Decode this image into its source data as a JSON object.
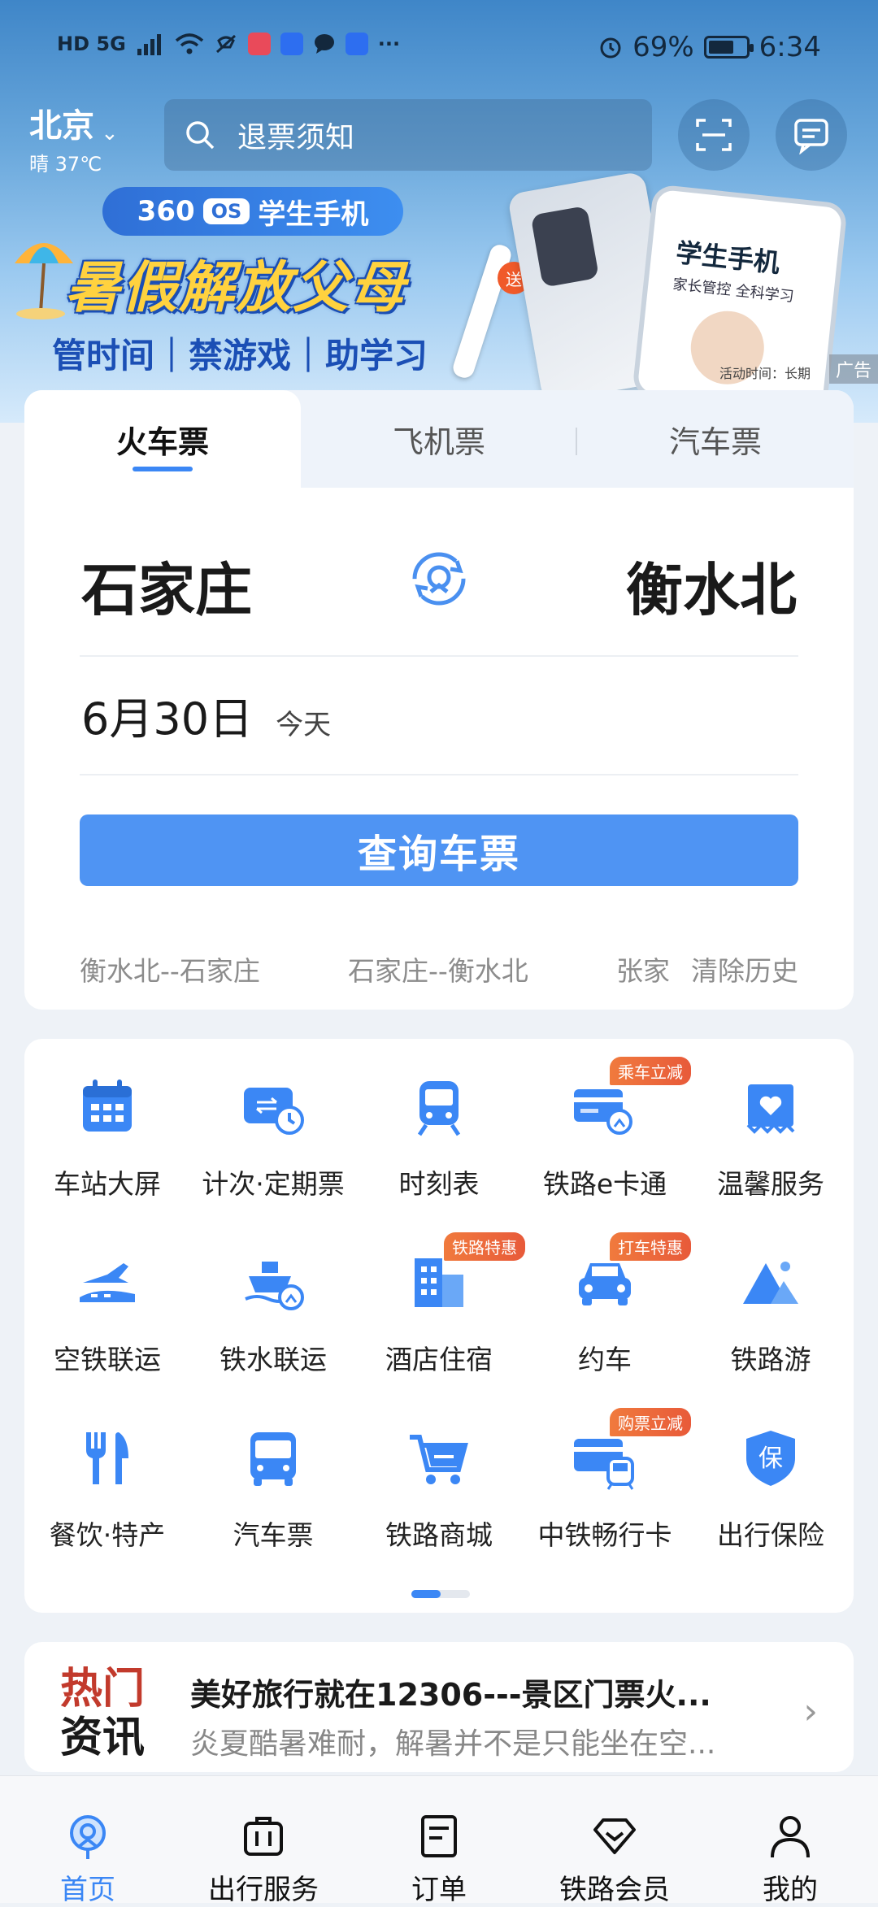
{
  "status_bar": {
    "network": "HD 5G",
    "battery_percent": "69%",
    "battery_level": 0.69,
    "time": "6:34"
  },
  "header": {
    "city": "北京",
    "weather": "晴 37℃",
    "search_placeholder": "退票须知"
  },
  "banner": {
    "os_brand": "360",
    "os_badge": "OS",
    "os_title": "学生手机",
    "headline": "暑假解放父母",
    "subline": "管时间｜禁游戏｜助学习",
    "phone_title": "学生手机",
    "phone_subtitle": "家长管控 全科学习",
    "gift_badge": "送",
    "activity": "活动时间：长期",
    "ad_label": "广告"
  },
  "booking": {
    "tabs": [
      {
        "label": "火车票",
        "active": true
      },
      {
        "label": "飞机票",
        "active": false
      },
      {
        "label": "汽车票",
        "active": false
      }
    ],
    "from_station": "石家庄",
    "to_station": "衡水北",
    "date": "6月30日",
    "day_label": "今天",
    "query_button": "查询车票",
    "history": [
      "衡水北--石家庄",
      "石家庄--衡水北",
      "张家"
    ],
    "clear_history": "清除历史"
  },
  "services": [
    {
      "label": "车站大屏",
      "icon": "calendar-icon",
      "badge": ""
    },
    {
      "label": "计次·定期票",
      "icon": "ticket-clock-icon",
      "badge": ""
    },
    {
      "label": "时刻表",
      "icon": "train-icon",
      "badge": ""
    },
    {
      "label": "铁路e卡通",
      "icon": "rail-card-icon",
      "badge": "乘车立减"
    },
    {
      "label": "温馨服务",
      "icon": "heart-service-icon",
      "badge": ""
    },
    {
      "label": "空铁联运",
      "icon": "plane-rail-icon",
      "badge": ""
    },
    {
      "label": "铁水联运",
      "icon": "ship-rail-icon",
      "badge": ""
    },
    {
      "label": "酒店住宿",
      "icon": "hotel-icon",
      "badge": "铁路特惠"
    },
    {
      "label": "约车",
      "icon": "car-icon",
      "badge": "打车特惠"
    },
    {
      "label": "铁路游",
      "icon": "mountain-icon",
      "badge": ""
    },
    {
      "label": "餐饮·特产",
      "icon": "fork-knife-icon",
      "badge": ""
    },
    {
      "label": "汽车票",
      "icon": "bus-icon",
      "badge": ""
    },
    {
      "label": "铁路商城",
      "icon": "cart-icon",
      "badge": ""
    },
    {
      "label": "中铁畅行卡",
      "icon": "card-train-icon",
      "badge": "购票立减"
    },
    {
      "label": "出行保险",
      "icon": "shield-insurance-icon",
      "badge": ""
    }
  ],
  "news": {
    "tag_line1": "热门",
    "tag_line2": "资讯",
    "title": "美好旅行就在12306---景区门票火...",
    "desc": "炎夏酷暑难耐，解暑并不是只能坐在空..."
  },
  "bottom_nav": [
    {
      "label": "首页",
      "icon": "home-rail-icon",
      "active": true
    },
    {
      "label": "出行服务",
      "icon": "suitcase-icon",
      "active": false
    },
    {
      "label": "订单",
      "icon": "order-list-icon",
      "active": false
    },
    {
      "label": "铁路会员",
      "icon": "diamond-icon",
      "active": false
    },
    {
      "label": "我的",
      "icon": "person-icon",
      "active": false
    }
  ],
  "colors": {
    "accent": "#3b87f5",
    "button": "#4f94f3",
    "badge": "#e85a3a",
    "headline": "#ffd23f"
  }
}
